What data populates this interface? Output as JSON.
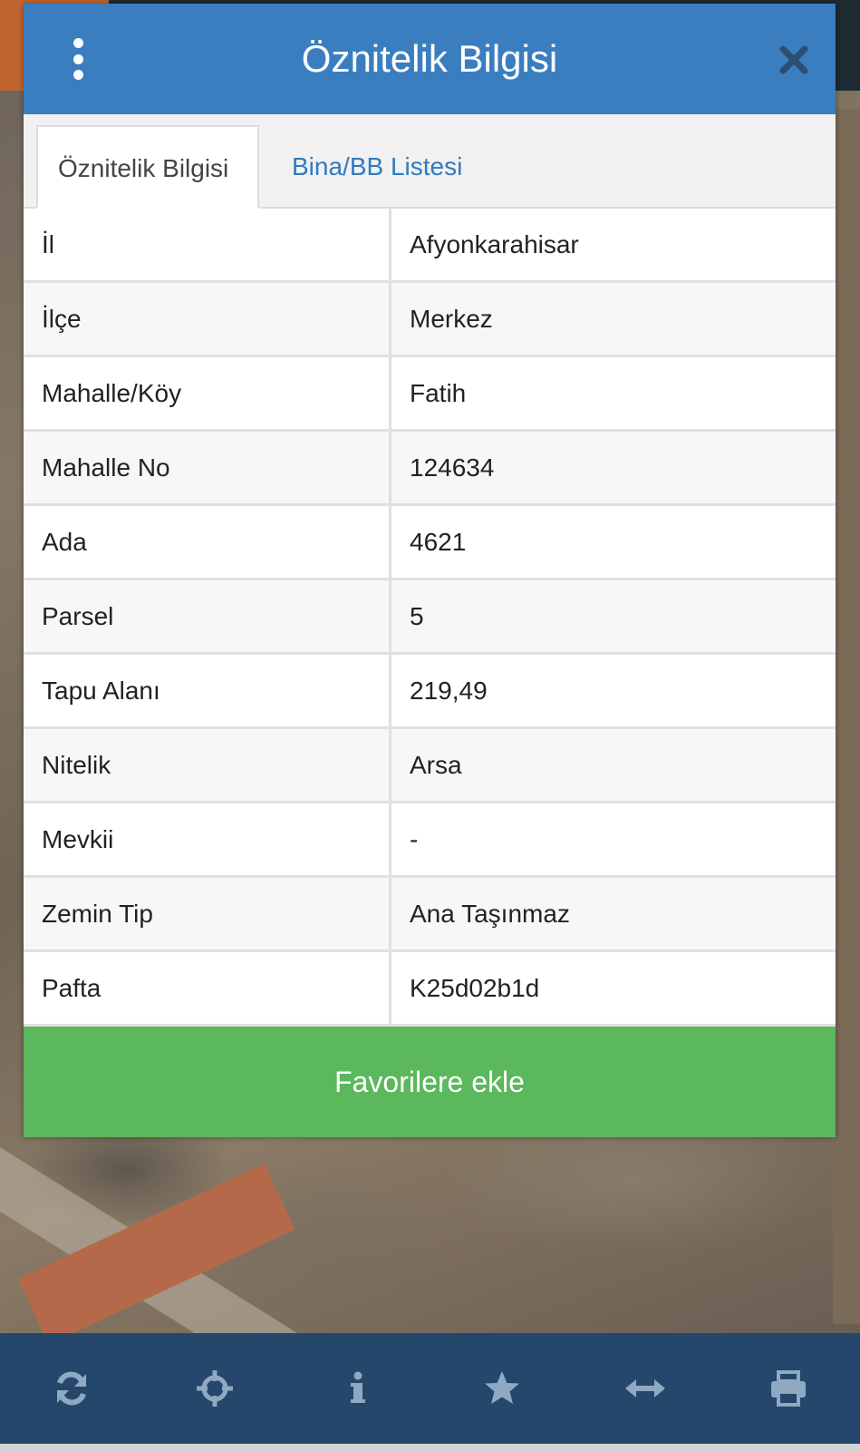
{
  "modal": {
    "title": "Öznitelik Bilgisi",
    "colors": {
      "header": "#3a7ec0",
      "favorite_button": "#5cb85c",
      "tab_link": "#2f7bbf"
    }
  },
  "tabs": [
    {
      "label": "Öznitelik Bilgisi",
      "active": true
    },
    {
      "label": "Bina/BB Listesi",
      "active": false
    }
  ],
  "attributes": [
    {
      "key": "İl",
      "value": "Afyonkarahisar"
    },
    {
      "key": "İlçe",
      "value": "Merkez"
    },
    {
      "key": "Mahalle/Köy",
      "value": "Fatih"
    },
    {
      "key": "Mahalle No",
      "value": "124634"
    },
    {
      "key": "Ada",
      "value": "4621"
    },
    {
      "key": "Parsel",
      "value": "5"
    },
    {
      "key": "Tapu Alanı",
      "value": "219,49"
    },
    {
      "key": "Nitelik",
      "value": "Arsa"
    },
    {
      "key": "Mevkii",
      "value": "-"
    },
    {
      "key": "Zemin Tip",
      "value": "Ana Taşınmaz"
    },
    {
      "key": "Pafta",
      "value": "K25d02b1d"
    }
  ],
  "favorite_button": {
    "label": "Favorilere ekle"
  },
  "toolbar": {
    "color": "#24476b",
    "icons": [
      "refresh-icon",
      "crosshair-icon",
      "info-icon",
      "star-icon",
      "horizontal-arrows-icon",
      "print-icon"
    ]
  }
}
